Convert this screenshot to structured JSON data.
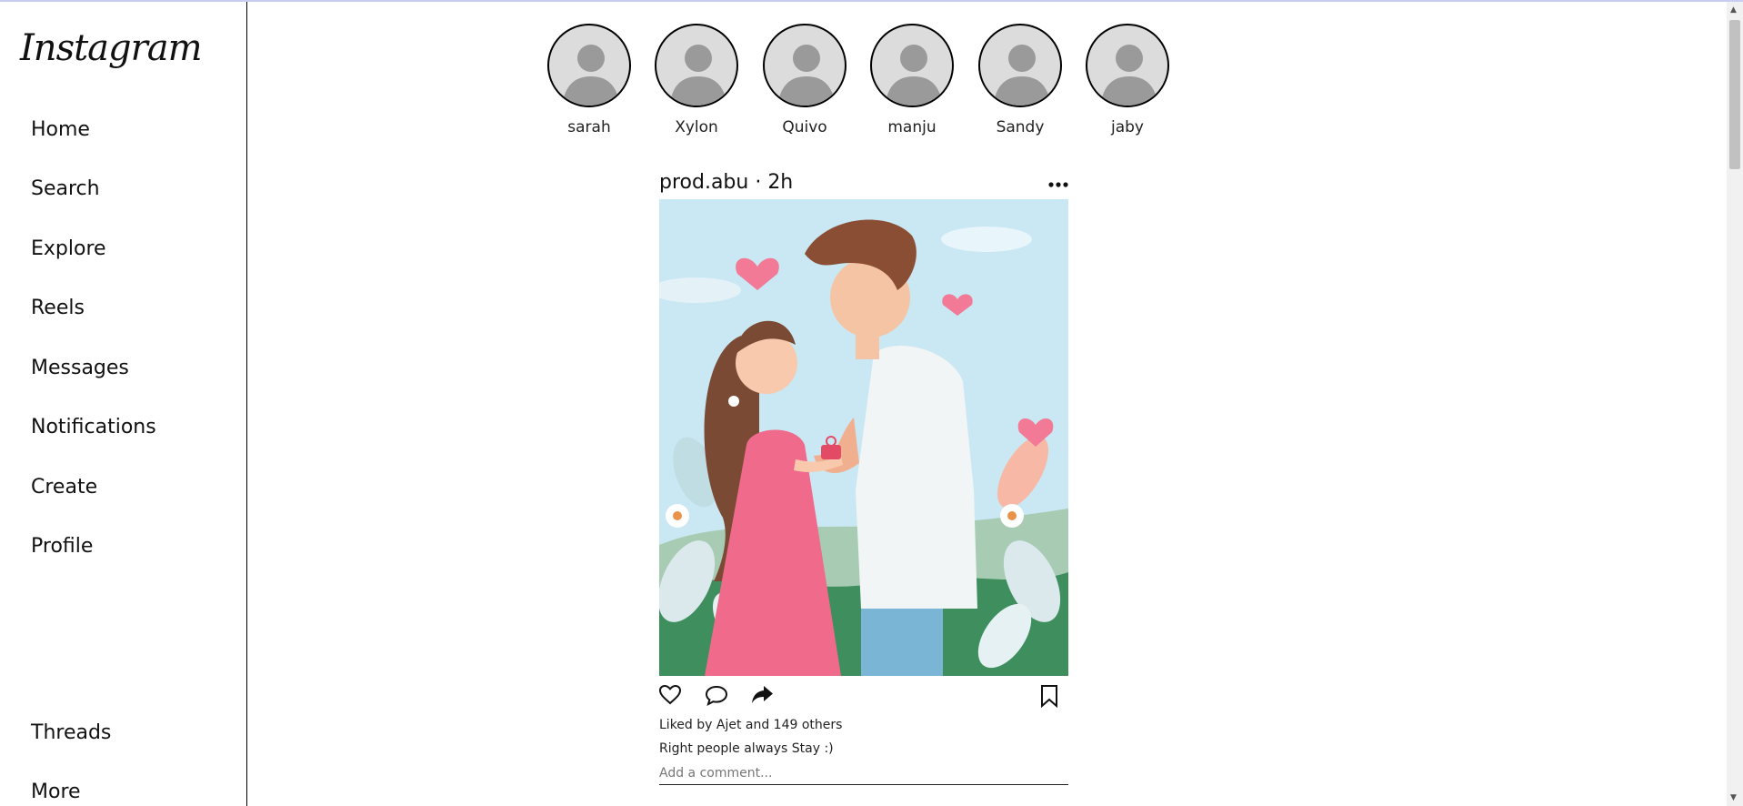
{
  "app": {
    "logo": "Instagram"
  },
  "sidebar": {
    "items": [
      {
        "label": "Home"
      },
      {
        "label": "Search"
      },
      {
        "label": "Explore"
      },
      {
        "label": "Reels"
      },
      {
        "label": "Messages"
      },
      {
        "label": "Notifications"
      },
      {
        "label": "Create"
      },
      {
        "label": "Profile"
      }
    ],
    "bottom_items": [
      {
        "label": "Threads"
      },
      {
        "label": "More"
      }
    ]
  },
  "stories": [
    {
      "name": "sarah"
    },
    {
      "name": "Xylon"
    },
    {
      "name": "Quivo"
    },
    {
      "name": "manju"
    },
    {
      "name": "Sandy"
    },
    {
      "name": "jaby"
    }
  ],
  "post": {
    "header": "prod.abu · 2h",
    "more_icon": "more-horizontal-icon",
    "likes_text": "Liked by Ajet and 149 others",
    "caption": "Right people always Stay :)",
    "comment_placeholder": "Add a comment...",
    "icons": [
      "heart-icon",
      "comment-icon",
      "share-icon",
      "bookmark-icon"
    ]
  },
  "colors": {
    "border": "#000000",
    "story_bg": "#dcdcdc",
    "avatar_silhouette": "#9a9a9a",
    "sky": "#c9e8f3",
    "dress": "#f06a8b"
  }
}
